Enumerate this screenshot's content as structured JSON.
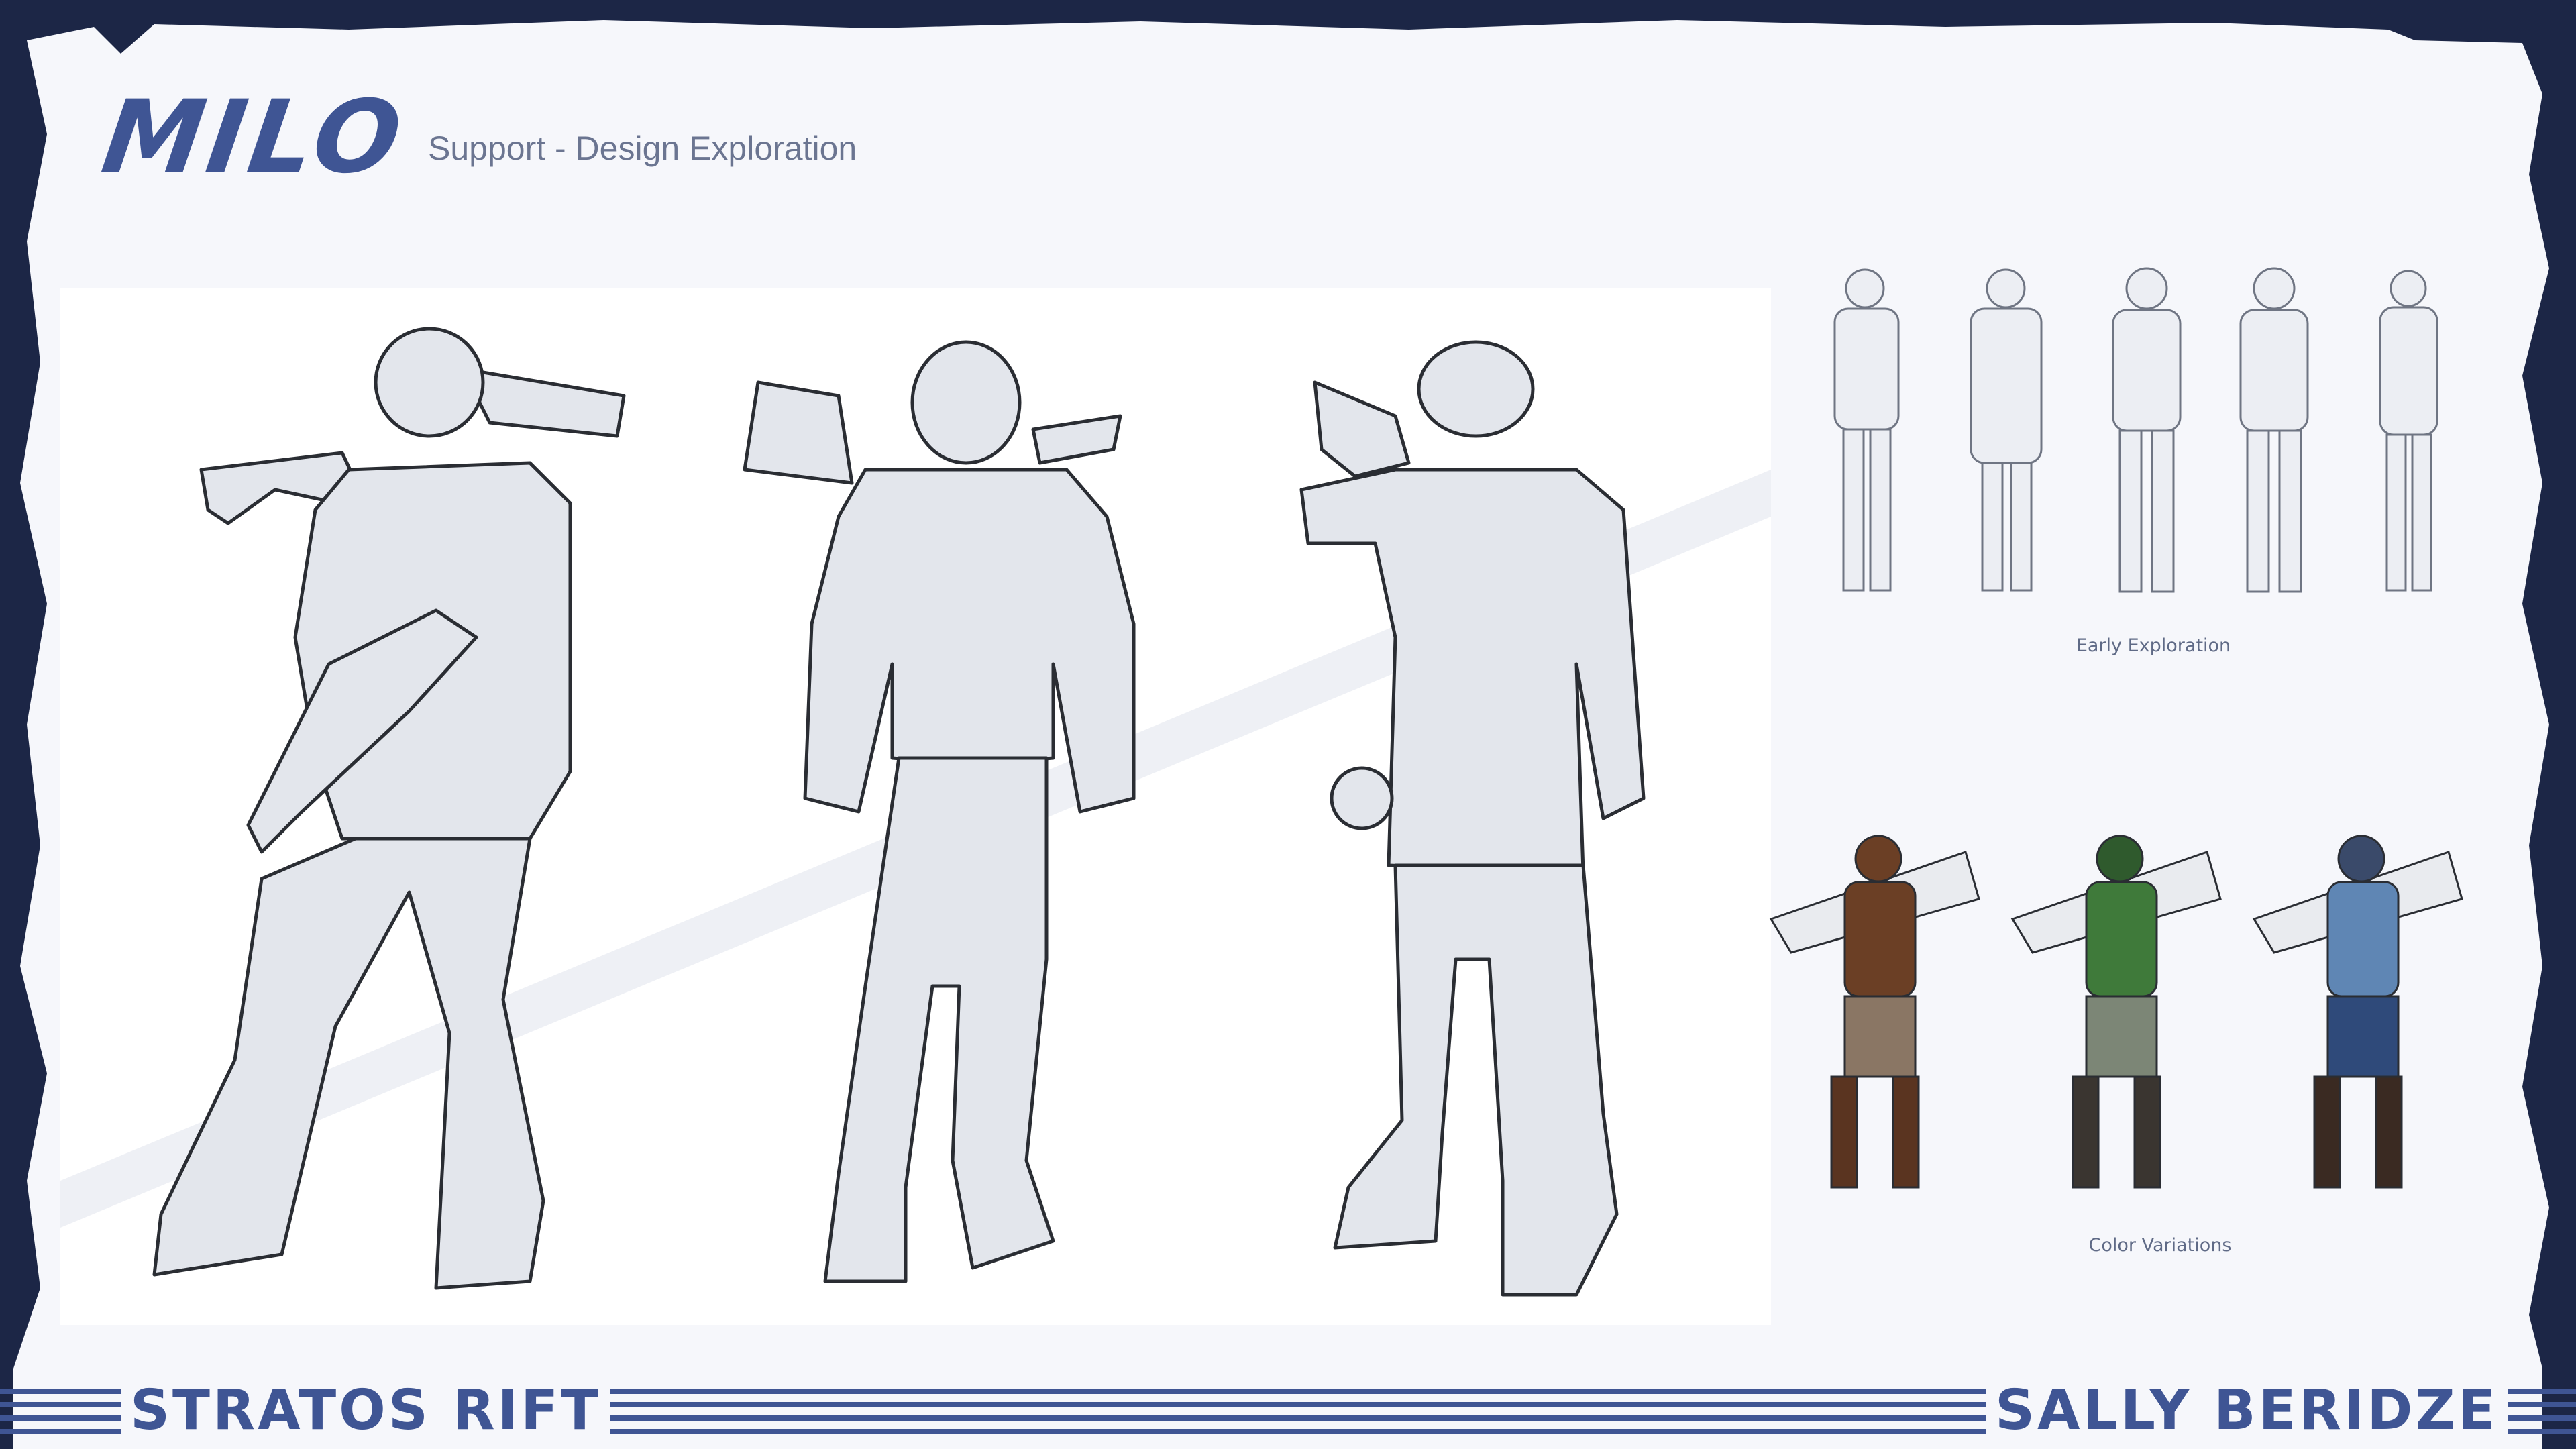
{
  "header": {
    "title": "MILO",
    "subtitle": "Support - Design Exploration"
  },
  "captions": {
    "early": "Early Exploration",
    "colors": "Color Variations"
  },
  "footer": {
    "left_brand": "STRATOS RIFT",
    "right_brand": "SALLY BERIDZE"
  },
  "palette": {
    "frame": "#1c2646",
    "paper": "#f6f7fb",
    "accent": "#3f5594",
    "sketch_fill": "#e3e6ec",
    "sketch_line": "#2a2d33",
    "variant_brown": "#6b3f25",
    "variant_green": "#3f7a3a",
    "variant_blue": "#5f86b4"
  }
}
